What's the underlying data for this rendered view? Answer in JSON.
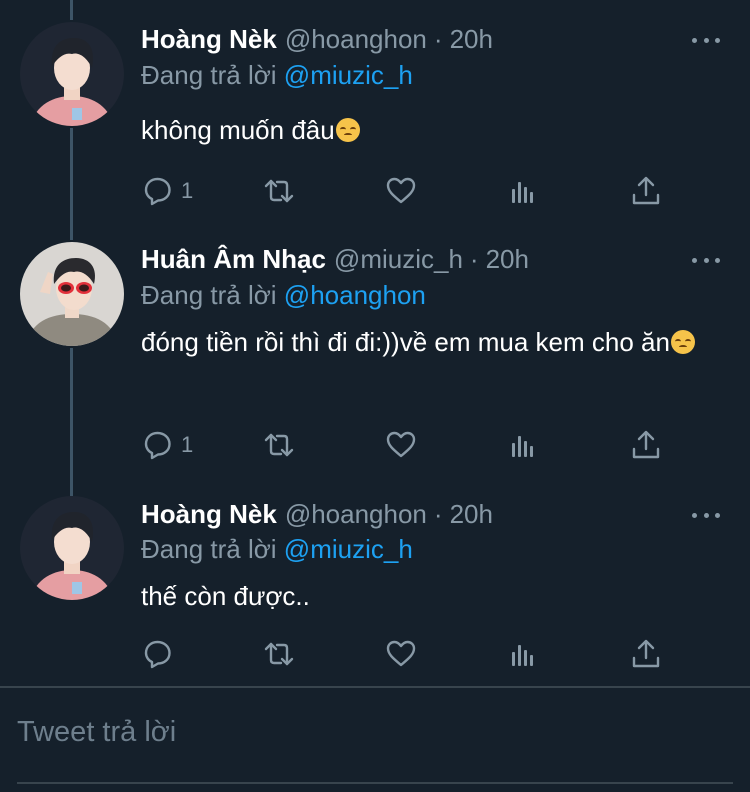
{
  "tweets": [
    {
      "name": "Hoàng Nèk",
      "handle": "@hoanghon",
      "separator": "·",
      "time": "20h",
      "replying_prefix": "Đang trả lời",
      "replying_to": "@miuzic_h",
      "text": "không muốn đâu",
      "emoji": "disappointed-face",
      "avatar": "avatar-hoang",
      "reply_count": "1"
    },
    {
      "name": "Huân Âm Nhạc",
      "handle": "@miuzic_h",
      "separator": "·",
      "time": "20h",
      "replying_prefix": "Đang trả lời",
      "replying_to": "@hoanghon",
      "text": "đóng tiền rồi thì đi đi:))về em mua kem cho ăn",
      "emoji": "disappointed-face",
      "avatar": "avatar-huan",
      "reply_count": "1"
    },
    {
      "name": "Hoàng Nèk",
      "handle": "@hoanghon",
      "separator": "·",
      "time": "20h",
      "replying_prefix": "Đang trả lời",
      "replying_to": "@miuzic_h",
      "text": "thế còn được..",
      "emoji": "",
      "avatar": "avatar-hoang",
      "reply_count": ""
    }
  ],
  "action_icons": [
    "reply-icon",
    "retweet-icon",
    "like-icon",
    "analytics-icon",
    "share-icon"
  ],
  "reply_input": {
    "placeholder": "Tweet trả lời"
  },
  "colors": {
    "background": "#15202b",
    "text": "#ffffff",
    "secondary": "#8899a6",
    "link": "#1da1f2",
    "divider": "#38444d",
    "thread_line": "#3d5466"
  }
}
